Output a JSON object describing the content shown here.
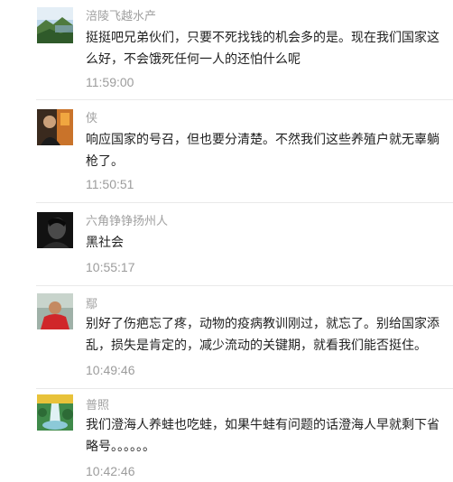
{
  "comments": [
    {
      "name": "涪陵飞越水产",
      "text": "挺挺吧兄弟伙们，只要不死找钱的机会多的是。现在我们国家这么好，不会饿死任何一人的还怕什么呢",
      "time": "11:59:00",
      "avatar_icon": "landscape-avatar"
    },
    {
      "name": "侠",
      "text": "响应国家的号召，但也要分清楚。不然我们这些养殖户就无辜躺枪了。",
      "time": "11:50:51",
      "avatar_icon": "portrait-avatar"
    },
    {
      "name": "六角铮铮扬州人",
      "text": "黑社会",
      "time": "10:55:17",
      "avatar_icon": "dark-portrait-avatar"
    },
    {
      "name": "鄢",
      "text": "别好了伤疤忘了疼，动物的疫病教训刚过，就忘了。别给国家添乱，损失是肯定的，减少流动的关键期，就看我们能否挺住。",
      "time": "10:49:46",
      "avatar_icon": "red-shirt-avatar"
    },
    {
      "name": "普照",
      "text": "我们澄海人养蛙也吃蛙，如果牛蛙有问题的话澄海人早就剩下省略号。。。。。。",
      "time": "10:42:46",
      "avatar_icon": "waterfall-avatar"
    }
  ]
}
